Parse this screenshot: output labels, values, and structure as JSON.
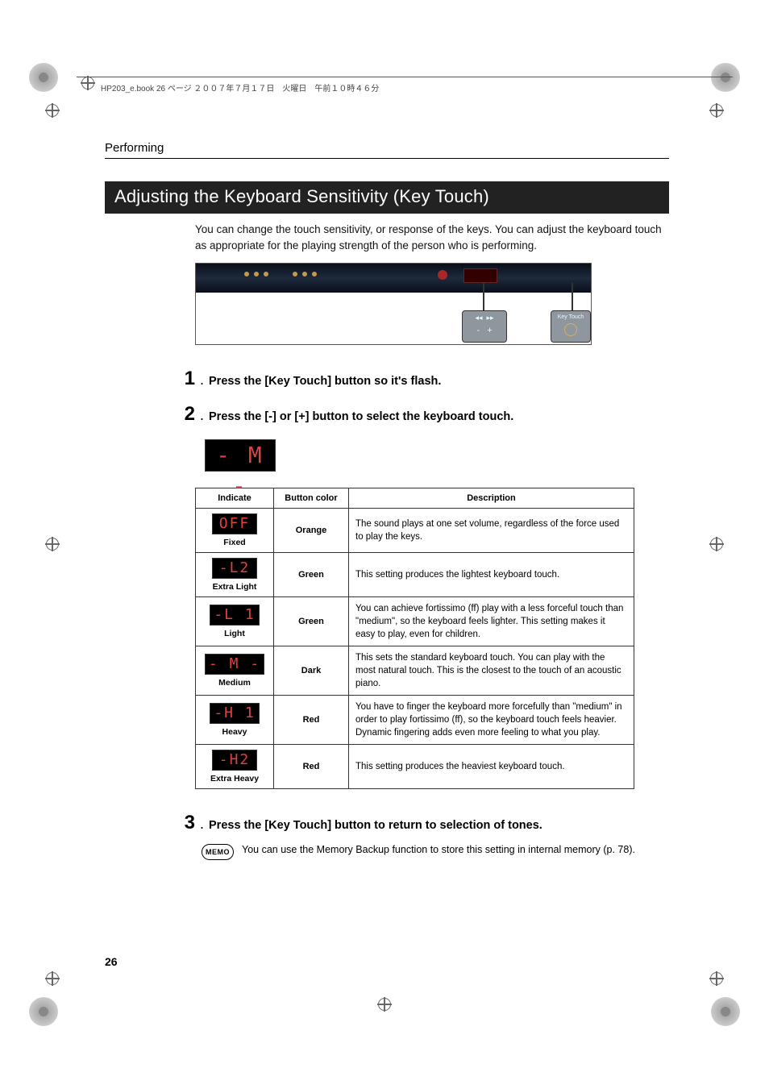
{
  "header_text": "HP203_e.book 26 ページ ２００７年７月１７日　火曜日　午前１０時４６分",
  "running_head": "Performing",
  "section_title": "Adjusting the Keyboard Sensitivity (Key Touch)",
  "intro": "You can change the touch sensitivity, or response of the keys. You can adjust the keyboard touch as appropriate for the playing strength of the person who is performing.",
  "steps": {
    "s1": "Press the [Key Touch] button so it's flash.",
    "s2": "Press the [-] or [+] button to select the keyboard touch.",
    "s3": "Press the [Key Touch] button to return to selection of tones."
  },
  "display_value": "- M -",
  "table": {
    "headers": {
      "indicate": "Indicate",
      "button_color": "Button color",
      "description": "Description"
    },
    "rows": [
      {
        "disp": "OFF",
        "label": "Fixed",
        "color": "Orange",
        "desc": "The sound plays at one set volume, regardless of the force used to play the keys."
      },
      {
        "disp": "-L2",
        "label": "Extra Light",
        "color": "Green",
        "desc": "This setting produces the lightest keyboard touch."
      },
      {
        "disp": "-L 1",
        "label": "Light",
        "color": "Green",
        "desc": "You can achieve fortissimo (ff) play with a less forceful touch than \"medium\", so the keyboard feels lighter. This setting makes it easy to play, even for children."
      },
      {
        "disp": "- M -",
        "label": "Medium",
        "color": "Dark",
        "desc": "This sets the standard keyboard touch. You can play with the most natural touch. This is the closest to the touch of an acoustic piano."
      },
      {
        "disp": "-H 1",
        "label": "Heavy",
        "color": "Red",
        "desc": "You have to finger the keyboard more forcefully than \"medium\" in order to play fortissimo (ff), so the keyboard touch feels heavier. Dynamic fingering adds even more feeling to what you play."
      },
      {
        "disp": "-H2",
        "label": "Extra Heavy",
        "color": "Red",
        "desc": "This setting produces the heaviest keyboard touch."
      }
    ]
  },
  "memo": {
    "badge": "MEMO",
    "text": "You can use the Memory Backup function to store this setting in internal memory (p. 78)."
  },
  "page_number": "26",
  "callout_labels": {
    "minus": "-",
    "plus": "+",
    "prev": "◂◂",
    "next": "▸▸",
    "key_touch": "Key Touch"
  }
}
